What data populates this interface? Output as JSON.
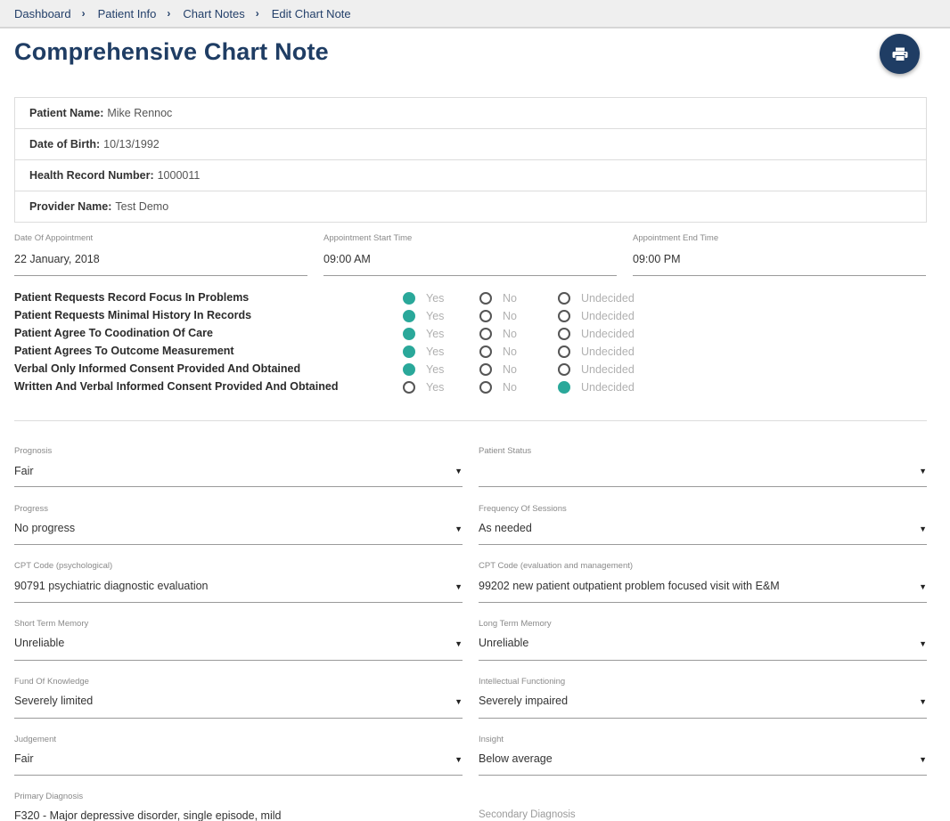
{
  "breadcrumb": {
    "items": [
      "Dashboard",
      "Patient Info",
      "Chart Notes",
      "Edit Chart Note"
    ],
    "separator": "›"
  },
  "page": {
    "title": "Comprehensive Chart Note",
    "print_icon": "printer-icon"
  },
  "patient": {
    "name_label": "Patient Name:",
    "name": "Mike Rennoc",
    "dob_label": "Date of Birth:",
    "dob": "10/13/1992",
    "hrn_label": "Health Record Number:",
    "hrn": "1000011",
    "provider_label": "Provider Name:",
    "provider": "Test Demo"
  },
  "appointment": {
    "date_label": "Date Of Appointment",
    "date": "22 January, 2018",
    "start_label": "Appointment Start Time",
    "start": "09:00 AM",
    "end_label": "Appointment End Time",
    "end": "09:00 PM"
  },
  "consent": {
    "options": [
      "Yes",
      "No",
      "Undecided"
    ],
    "questions": [
      {
        "label": "Patient Requests Record Focus In Problems",
        "selected": "Yes"
      },
      {
        "label": "Patient Requests Minimal History In Records",
        "selected": "Yes"
      },
      {
        "label": "Patient Agree To Coodination Of Care",
        "selected": "Yes"
      },
      {
        "label": "Patient Agrees To Outcome Measurement",
        "selected": "Yes"
      },
      {
        "label": "Verbal Only Informed Consent Provided And Obtained",
        "selected": "Yes"
      },
      {
        "label": "Written And Verbal Informed Consent Provided And Obtained",
        "selected": "Undecided"
      }
    ]
  },
  "selects": {
    "prognosis": {
      "label": "Prognosis",
      "value": "Fair"
    },
    "patient_status": {
      "label": "Patient Status",
      "value": ""
    },
    "progress": {
      "label": "Progress",
      "value": "No progress"
    },
    "frequency": {
      "label": "Frequency Of Sessions",
      "value": "As needed"
    },
    "cpt_psych": {
      "label": "CPT Code (psychological)",
      "value": "90791 psychiatric diagnostic evaluation"
    },
    "cpt_em": {
      "label": "CPT Code (evaluation and management)",
      "value": "99202 new patient outpatient problem focused visit with E&M"
    },
    "short_memory": {
      "label": "Short Term Memory",
      "value": "Unreliable"
    },
    "long_memory": {
      "label": "Long Term Memory",
      "value": "Unreliable"
    },
    "fund_knowledge": {
      "label": "Fund Of Knowledge",
      "value": "Severely limited"
    },
    "intellectual": {
      "label": "Intellectual Functioning",
      "value": "Severely impaired"
    },
    "judgement": {
      "label": "Judgement",
      "value": "Fair"
    },
    "insight": {
      "label": "Insight",
      "value": "Below average"
    },
    "primary_dx": {
      "label": "Primary Diagnosis",
      "value": "F320 - Major depressive disorder, single episode, mild"
    },
    "secondary_dx": {
      "label": "Secondary Diagnosis",
      "value": ""
    }
  },
  "colors": {
    "primary": "#1f3d64",
    "accent": "#2aa89a"
  }
}
